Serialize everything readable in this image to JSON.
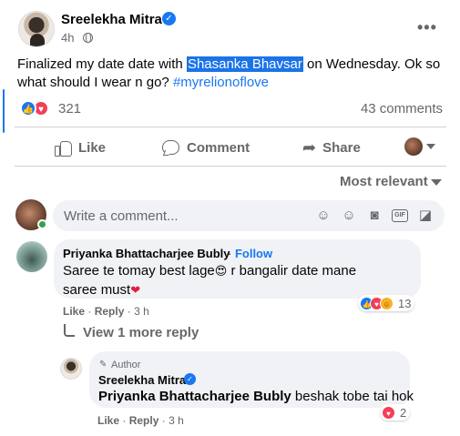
{
  "post": {
    "author": "Sreelekha Mitra",
    "time": "4h",
    "text_before": "Finalized my date date with ",
    "text_highlight": "Shasanka Bhavsar",
    "text_after": " on Wednesday. Ok so what should I wear n go? ",
    "hashtag": "#myrelionoflove",
    "reaction_count": "321",
    "comment_count": "43 comments"
  },
  "actions": {
    "like": "Like",
    "comment": "Comment",
    "share": "Share"
  },
  "sort": {
    "label": "Most relevant"
  },
  "composer": {
    "placeholder": "Write a comment..."
  },
  "icons": {
    "emoji_1": "😍",
    "emoji_2": "❤"
  },
  "comments": [
    {
      "author": "Priyanka Bhattacharjee Bubly",
      "follow": "Follow",
      "text_1": "Saree te tomay best lage",
      "text_2": " r bangalir date mane saree must",
      "like": "Like",
      "reply": "Reply",
      "time": "3 h",
      "reaction_count": "13",
      "view_more": "View 1 more reply"
    }
  ],
  "reply": {
    "badge": "Author",
    "author": "Sreelekha Mitra",
    "mention": "Priyanka Bhattacharjee Bubly",
    "text": " beshak tobe tai hok",
    "like": "Like",
    "reply": "Reply",
    "time": "3 h",
    "reaction_count": "2"
  },
  "colors": {
    "accent": "#1877f2",
    "love": "#f33e58",
    "muted_text": "#65676b",
    "bubble_bg": "#f0f2f5",
    "online": "#31a24c"
  }
}
